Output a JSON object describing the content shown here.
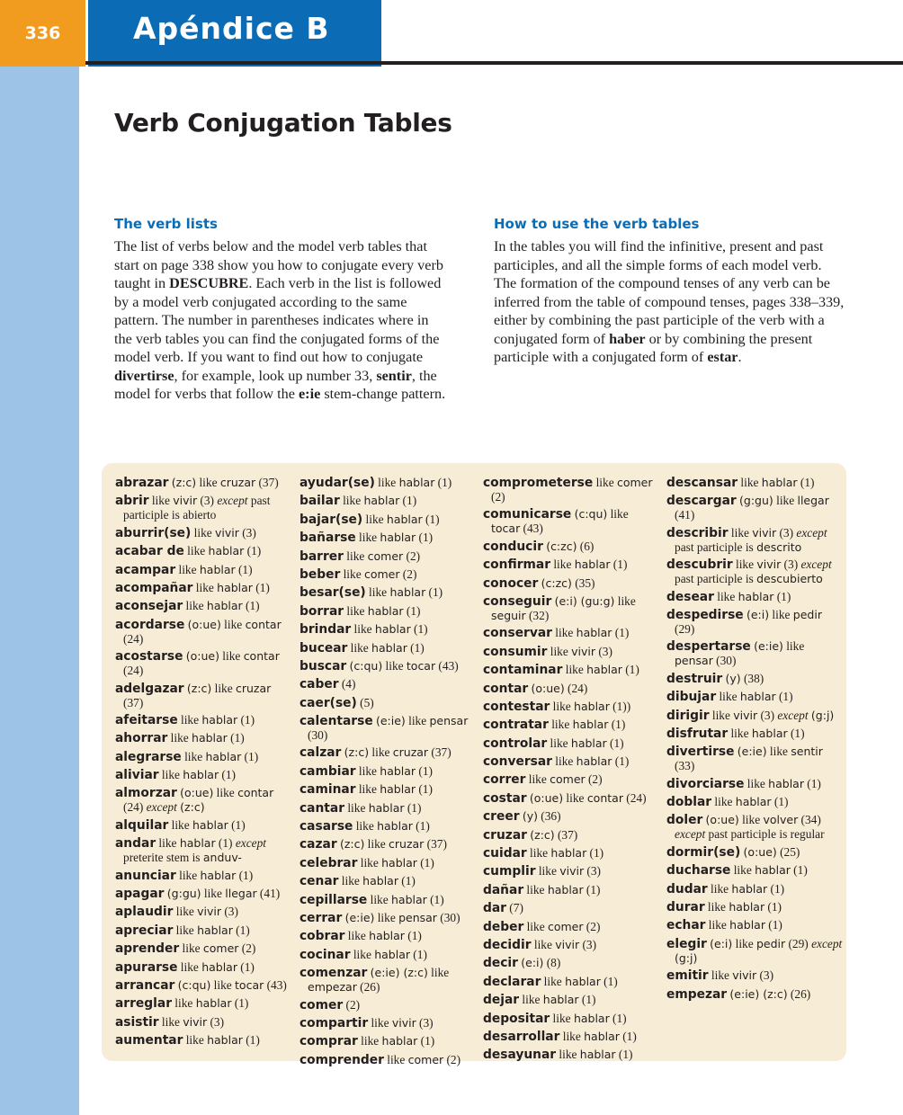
{
  "header": {
    "page_number": "336",
    "appendix_title": "Apéndice B"
  },
  "title": "Verb Conjugation Tables",
  "sections": {
    "verb_lists": {
      "heading": "The verb lists",
      "body_html": "The list of verbs below and the model verb tables that start on page 338 show you how to conjugate every verb taught in <b>DESCUBRE</b>. Each verb in the list is followed by a model verb conjugated according to the same pattern. The number in parentheses indicates where in the verb tables you can find the conjugated forms of the model verb. If you want to find out how to conjugate <b>divertirse</b>, for example, look up number 33, <b>sentir</b>, the model for verbs that follow the <b>e:ie</b> stem-change pattern."
    },
    "how_to_use": {
      "heading": "How to use the verb tables",
      "body_html": "In the tables you will find the infinitive, present and past participles, and all the simple forms of each model verb. The formation of the compound tenses of any verb can be inferred from the table of compound tenses, pages 338–339, either by combining the past participle of the verb with a conjugated form of <b>haber</b> or by combining the present participle with a conjugated form of <b>estar</b>."
    }
  },
  "verb_columns": [
    [
      {
        "verb": "abrazar",
        "mark": "(z:c)",
        "like": "like",
        "model": "cruzar",
        "num": "(37)"
      },
      {
        "verb": "abrir",
        "like": "like",
        "model": "vivir",
        "num": "(3)",
        "note_html": "<i>except</i> past participle is abierto"
      },
      {
        "verb": "aburrir(se)",
        "like": "like",
        "model": "vivir",
        "num": "(3)"
      },
      {
        "verb": "acabar de",
        "like": "like",
        "model": "hablar",
        "num": "(1)"
      },
      {
        "verb": "acampar",
        "like": "like",
        "model": "hablar",
        "num": "(1)"
      },
      {
        "verb": "acompañar",
        "like": "like",
        "model": "hablar",
        "num": "(1)"
      },
      {
        "verb": "aconsejar",
        "like": "like",
        "model": "hablar",
        "num": "(1)"
      },
      {
        "verb": "acordarse",
        "mark": "(o:ue)",
        "like": "like",
        "model": "contar",
        "num": "(24)"
      },
      {
        "verb": "acostarse",
        "mark": "(o:ue)",
        "like": "like",
        "model": "contar",
        "num": "(24)"
      },
      {
        "verb": "adelgazar",
        "mark": "(z:c)",
        "like": "like",
        "model": "cruzar",
        "num": "(37)"
      },
      {
        "verb": "afeitarse",
        "like": "like",
        "model": "hablar",
        "num": "(1)"
      },
      {
        "verb": "ahorrar",
        "like": "like",
        "model": "hablar",
        "num": "(1)"
      },
      {
        "verb": "alegrarse",
        "like": "like",
        "model": "hablar",
        "num": "(1)"
      },
      {
        "verb": "aliviar",
        "like": "like",
        "model": "hablar",
        "num": "(1)"
      },
      {
        "verb": "almorzar",
        "mark": "(o:ue)",
        "like": "like",
        "model": "contar",
        "num": "(24)",
        "note_html": "<i>except</i> <span class=\"m\">(z:c)</span>"
      },
      {
        "verb": "alquilar",
        "like": "like",
        "model": "hablar",
        "num": "(1)"
      },
      {
        "verb": "andar",
        "like": "like",
        "model": "hablar",
        "num": "(1)",
        "note_html": "<i>except</i> preterite stem is <span class=\"m\">anduv-</span>"
      },
      {
        "verb": "anunciar",
        "like": "like",
        "model": "hablar",
        "num": "(1)"
      },
      {
        "verb": "apagar",
        "mark": "(g:gu)",
        "like": "like",
        "model": "llegar",
        "num": "(41)"
      },
      {
        "verb": "aplaudir",
        "like": "like",
        "model": "vivir",
        "num": "(3)"
      },
      {
        "verb": "apreciar",
        "like": "like",
        "model": "hablar",
        "num": "(1)"
      },
      {
        "verb": "aprender",
        "like": "like",
        "model": "comer",
        "num": "(2)"
      },
      {
        "verb": "apurarse",
        "like": "like",
        "model": "hablar",
        "num": "(1)"
      },
      {
        "verb": "arrancar",
        "mark": "(c:qu)",
        "like": "like",
        "model": "tocar",
        "num": "(43)"
      },
      {
        "verb": "arreglar",
        "like": "like",
        "model": "hablar",
        "num": "(1)"
      },
      {
        "verb": "asistir",
        "like": "like",
        "model": "vivir",
        "num": "(3)"
      },
      {
        "verb": "aumentar",
        "like": "like",
        "model": "hablar",
        "num": "(1)"
      }
    ],
    [
      {
        "verb": "ayudar(se)",
        "like": "like",
        "model": "hablar",
        "num": "(1)"
      },
      {
        "verb": "bailar",
        "like": "like",
        "model": "hablar",
        "num": "(1)"
      },
      {
        "verb": "bajar(se)",
        "like": "like",
        "model": "hablar",
        "num": "(1)"
      },
      {
        "verb": "bañarse",
        "like": "like",
        "model": "hablar",
        "num": "(1)"
      },
      {
        "verb": "barrer",
        "like": "like",
        "model": "comer",
        "num": "(2)"
      },
      {
        "verb": "beber",
        "like": "like",
        "model": "comer",
        "num": "(2)"
      },
      {
        "verb": "besar(se)",
        "like": "like",
        "model": "hablar",
        "num": "(1)"
      },
      {
        "verb": "borrar",
        "like": "like",
        "model": "hablar",
        "num": "(1)"
      },
      {
        "verb": "brindar",
        "like": "like",
        "model": "hablar",
        "num": "(1)"
      },
      {
        "verb": "bucear",
        "like": "like",
        "model": "hablar",
        "num": "(1)"
      },
      {
        "verb": "buscar",
        "mark": "(c:qu)",
        "like": "like",
        "model": "tocar",
        "num": "(43)"
      },
      {
        "verb": "caber",
        "num": "(4)"
      },
      {
        "verb": "caer(se)",
        "num": "(5)"
      },
      {
        "verb": "calentarse",
        "mark": "(e:ie)",
        "like": "like",
        "model": "pensar",
        "num": "(30)"
      },
      {
        "verb": "calzar",
        "mark": "(z:c)",
        "like": "like",
        "model": "cruzar",
        "num": "(37)"
      },
      {
        "verb": "cambiar",
        "like": "like",
        "model": "hablar",
        "num": "(1)"
      },
      {
        "verb": "caminar",
        "like": "like",
        "model": "hablar",
        "num": "(1)"
      },
      {
        "verb": "cantar",
        "like": "like",
        "model": "hablar",
        "num": "(1)"
      },
      {
        "verb": "casarse",
        "like": "like",
        "model": "hablar",
        "num": "(1)"
      },
      {
        "verb": "cazar",
        "mark": "(z:c)",
        "like": "like",
        "model": "cruzar",
        "num": "(37)"
      },
      {
        "verb": "celebrar",
        "like": "like",
        "model": "hablar",
        "num": "(1)"
      },
      {
        "verb": "cenar",
        "like": "like",
        "model": "hablar",
        "num": "(1)"
      },
      {
        "verb": "cepillarse",
        "like": "like",
        "model": "hablar",
        "num": "(1)"
      },
      {
        "verb": "cerrar",
        "mark": "(e:ie)",
        "like": "like",
        "model": "pensar",
        "num": "(30)"
      },
      {
        "verb": "cobrar",
        "like": "like",
        "model": "hablar",
        "num": "(1)"
      },
      {
        "verb": "cocinar",
        "like": "like",
        "model": "hablar",
        "num": "(1)"
      },
      {
        "verb": "comenzar",
        "mark": "(e:ie) (z:c)",
        "like": "like",
        "model": "empezar",
        "num": "(26)"
      },
      {
        "verb": "comer",
        "num": "(2)"
      },
      {
        "verb": "compartir",
        "like": "like",
        "model": "vivir",
        "num": "(3)"
      },
      {
        "verb": "comprar",
        "like": "like",
        "model": "hablar",
        "num": "(1)"
      },
      {
        "verb": "comprender",
        "like": "like",
        "model": "comer",
        "num": "(2)"
      }
    ],
    [
      {
        "verb": "comprometerse",
        "like": "like",
        "model": "comer",
        "num": "(2)"
      },
      {
        "verb": "comunicarse",
        "mark": "(c:qu)",
        "like": "like",
        "model": "tocar",
        "num": "(43)"
      },
      {
        "verb": "conducir",
        "mark": "(c:zc)",
        "num": "(6)"
      },
      {
        "verb": "confirmar",
        "like": "like",
        "model": "hablar",
        "num": "(1)"
      },
      {
        "verb": "conocer",
        "mark": "(c:zc)",
        "num": "(35)"
      },
      {
        "verb": "conseguir",
        "mark": "(e:i) (gu:g)",
        "like": "like",
        "model": "seguir",
        "num": "(32)"
      },
      {
        "verb": "conservar",
        "like": "like",
        "model": "hablar",
        "num": "(1)"
      },
      {
        "verb": "consumir",
        "like": "like",
        "model": "vivir",
        "num": "(3)"
      },
      {
        "verb": "contaminar",
        "like": "like",
        "model": "hablar",
        "num": "(1)"
      },
      {
        "verb": "contar",
        "mark": "(o:ue)",
        "num": "(24)"
      },
      {
        "verb": "contestar",
        "like": "like",
        "model": "hablar",
        "num": "(1))"
      },
      {
        "verb": "contratar",
        "like": "like",
        "model": "hablar",
        "num": "(1)"
      },
      {
        "verb": "controlar",
        "like": "like",
        "model": "hablar",
        "num": "(1)"
      },
      {
        "verb": "conversar",
        "like": "like",
        "model": "hablar",
        "num": "(1)"
      },
      {
        "verb": "correr",
        "like": "like",
        "model": "comer",
        "num": "(2)"
      },
      {
        "verb": "costar",
        "mark": "(o:ue)",
        "like": "like",
        "model": "contar",
        "num": "(24)"
      },
      {
        "verb": "creer",
        "mark": "(y)",
        "num": "(36)"
      },
      {
        "verb": "cruzar",
        "mark": "(z:c)",
        "num": "(37)"
      },
      {
        "verb": "cuidar",
        "like": "like",
        "model": "hablar",
        "num": "(1)"
      },
      {
        "verb": "cumplir",
        "like": "like",
        "model": "vivir",
        "num": "(3)"
      },
      {
        "verb": "dañar",
        "like": "like",
        "model": "hablar",
        "num": "(1)"
      },
      {
        "verb": "dar",
        "num": "(7)"
      },
      {
        "verb": "deber",
        "like": "like",
        "model": "comer",
        "num": "(2)"
      },
      {
        "verb": "decidir",
        "like": "like",
        "model": "vivir",
        "num": "(3)"
      },
      {
        "verb": "decir",
        "mark": "(e:i)",
        "num": "(8)"
      },
      {
        "verb": "declarar",
        "like": "like",
        "model": "hablar",
        "num": "(1)"
      },
      {
        "verb": "dejar",
        "like": "like",
        "model": "hablar",
        "num": "(1)"
      },
      {
        "verb": "depositar",
        "like": "like",
        "model": "hablar",
        "num": "(1)"
      },
      {
        "verb": "desarrollar",
        "like": "like",
        "model": "hablar",
        "num": "(1)"
      },
      {
        "verb": "desayunar",
        "like": "like",
        "model": "hablar",
        "num": "(1)"
      }
    ],
    [
      {
        "verb": "descansar",
        "like": "like",
        "model": "hablar",
        "num": "(1)"
      },
      {
        "verb": "descargar",
        "mark": "(g:gu)",
        "like": "like",
        "model": "llegar",
        "num": "(41)"
      },
      {
        "verb": "describir",
        "like": "like",
        "model": "vivir",
        "num": "(3)",
        "note_html": "<i>except</i> past participle is <span class=\"m\">descrito</span>"
      },
      {
        "verb": "descubrir",
        "like": "like",
        "model": "vivir",
        "num": "(3)",
        "note_html": "<i>except</i> past participle is <span class=\"m\">descubierto</span>"
      },
      {
        "verb": "desear",
        "like": "like",
        "model": "hablar",
        "num": "(1)"
      },
      {
        "verb": "despedirse",
        "mark": "(e:i)",
        "like": "like",
        "model": "pedir",
        "num": "(29)"
      },
      {
        "verb": "despertarse",
        "mark": "(e:ie)",
        "like": "like",
        "model": "pensar",
        "num": "(30)"
      },
      {
        "verb": "destruir",
        "mark": "(y)",
        "num": "(38)"
      },
      {
        "verb": "dibujar",
        "like": "like",
        "model": "hablar",
        "num": "(1)"
      },
      {
        "verb": "dirigir",
        "like": "like",
        "model": "vivir",
        "num": "(3)",
        "note_html": "<i>except</i> <span class=\"m\">(g:j)</span>"
      },
      {
        "verb": "disfrutar",
        "like": "like",
        "model": "hablar",
        "num": "(1)"
      },
      {
        "verb": "divertirse",
        "mark": "(e:ie)",
        "like": "like",
        "model": "sentir",
        "num": "(33)"
      },
      {
        "verb": "divorciarse",
        "like": "like",
        "model": "hablar",
        "num": "(1)"
      },
      {
        "verb": "doblar",
        "like": "like",
        "model": "hablar",
        "num": "(1)"
      },
      {
        "verb": "doler",
        "mark": "(o:ue)",
        "like": "like",
        "model": "volver",
        "num": "(34)",
        "note_html": "<i>except</i> past participle is regular"
      },
      {
        "verb": "dormir(se)",
        "mark": "(o:ue)",
        "num": "(25)"
      },
      {
        "verb": "ducharse",
        "like": "like",
        "model": "hablar",
        "num": "(1)"
      },
      {
        "verb": "dudar",
        "like": "like",
        "model": "hablar",
        "num": "(1)"
      },
      {
        "verb": "durar",
        "like": "like",
        "model": "hablar",
        "num": "(1)"
      },
      {
        "verb": "echar",
        "like": "like",
        "model": "hablar",
        "num": "(1)"
      },
      {
        "verb": "elegir",
        "mark": "(e:i)",
        "like": "like",
        "model": "pedir",
        "num": "(29)",
        "note_html": "<i>except</i> <span class=\"m\">(g:j)</span>"
      },
      {
        "verb": "emitir",
        "like": "like",
        "model": "vivir",
        "num": "(3)"
      },
      {
        "verb": "empezar",
        "mark": "(e:ie) (z:c)",
        "num": "(26)"
      }
    ]
  ]
}
